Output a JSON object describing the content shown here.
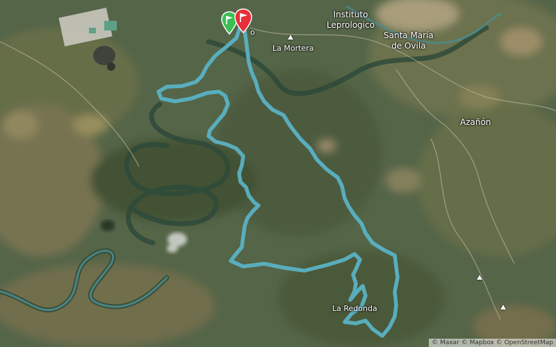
{
  "map": {
    "imagery": "satellite",
    "route_color": "#5ab4c8",
    "start_marker_color": "#3bbf52",
    "end_marker_color": "#e8303a",
    "places": [
      {
        "id": "instituto",
        "label": "Instituto\nLeprologico"
      },
      {
        "id": "santa-maria",
        "label": "Santa María\nde Ovila"
      },
      {
        "id": "la-mortera",
        "label": "La Mortera"
      },
      {
        "id": "azanon",
        "label": "Azañón"
      },
      {
        "id": "la-redonda",
        "label": "La Redonda"
      },
      {
        "id": "partial-label",
        "label": "o"
      }
    ],
    "icons": [
      "start-flag-icon",
      "finish-flag-icon",
      "peak-icon"
    ],
    "attribution": "© Maxar © Mapbox © OpenStreetMap"
  }
}
